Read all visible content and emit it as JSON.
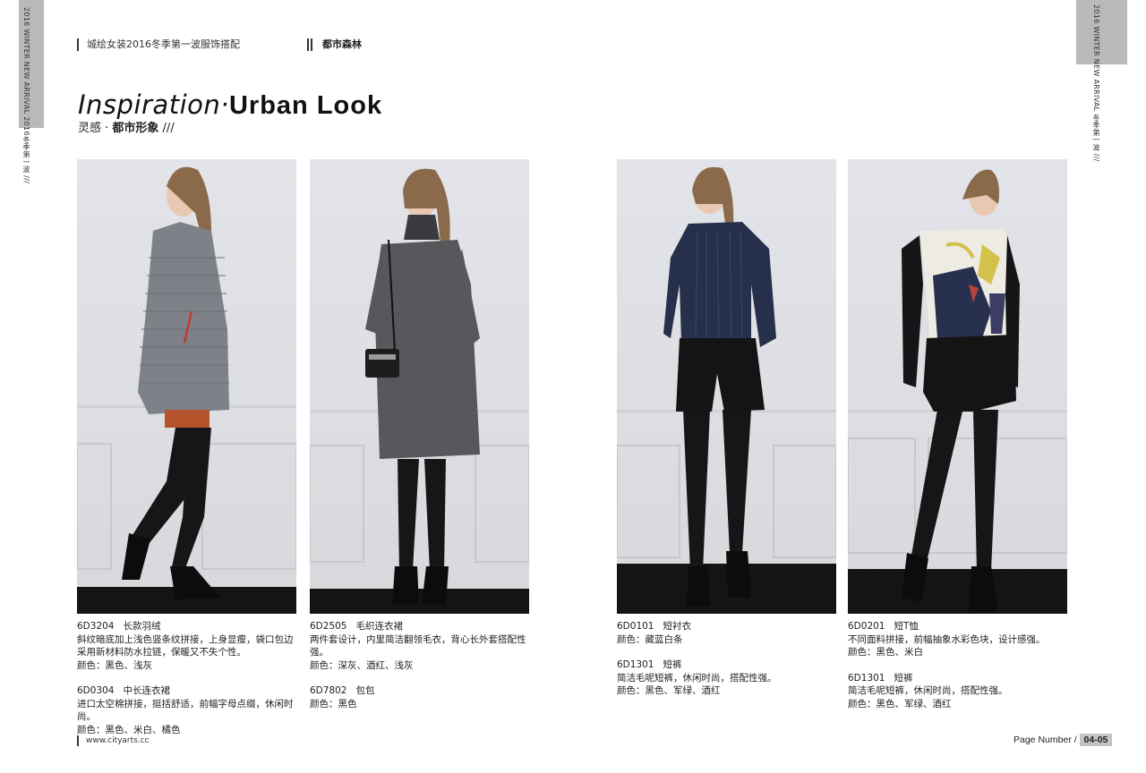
{
  "side_tabs": {
    "left": "2016 WINTER NEW ARRIVAL 2016冬季第一波 ///",
    "right": "2016 WINTER NEW ARRIVAL 冬季第一波 ///"
  },
  "header": {
    "title": "城绘女装2016冬季第一波服饰搭配",
    "section": "都市森林"
  },
  "heading": {
    "light": "Inspiration·",
    "bold": "Urban Look",
    "sub_light": "灵感 · ",
    "sub_bold": "都市形象",
    "sub_suffix": " ///"
  },
  "looks": [
    {
      "items": [
        {
          "code": "6D3204",
          "name": "长款羽绒",
          "lines": [
            "斜纹暗底加上浅色竖条纹拼接，上身显瘦，袋口包边采用新材料防水拉链，保暖又不失个性。",
            "颜色：黑色、浅灰"
          ]
        },
        {
          "code": "6D0304",
          "name": "中长连衣裙",
          "lines": [
            "进口太空棉拼接，挺括舒适，前幅字母点缀，休闲时尚。",
            "颜色：黑色、米白、橘色"
          ]
        }
      ]
    },
    {
      "items": [
        {
          "code": "6D2505",
          "name": "毛织连衣裙",
          "lines": [
            "两件套设计，内里简洁翻领毛衣，背心长外套搭配性强。",
            "颜色：深灰、酒红、浅灰"
          ]
        },
        {
          "code": "6D7802",
          "name": "包包",
          "lines": [
            "颜色：黑色"
          ]
        }
      ]
    },
    {
      "items": [
        {
          "code": "6D0101",
          "name": "短衬衣",
          "lines": [
            "颜色：藏蓝白条"
          ]
        },
        {
          "code": "6D1301",
          "name": "短裤",
          "lines": [
            "简洁毛呢短裤，休闲时尚，搭配性强。",
            "颜色：黑色、军绿、酒红"
          ]
        }
      ]
    },
    {
      "items": [
        {
          "code": "6D0201",
          "name": "短T恤",
          "lines": [
            "不同面料拼接，前幅抽象水彩色块，设计感强。",
            "颜色：黑色、米白"
          ]
        },
        {
          "code": "6D1301",
          "name": "短裤",
          "lines": [
            "简洁毛呢短裤，休闲时尚，搭配性强。",
            "颜色：黑色、军绿、酒红"
          ]
        }
      ]
    }
  ],
  "footer": {
    "url": "www.cityarts.cc",
    "page_label": "Page Number /",
    "page_range": "04-05"
  }
}
